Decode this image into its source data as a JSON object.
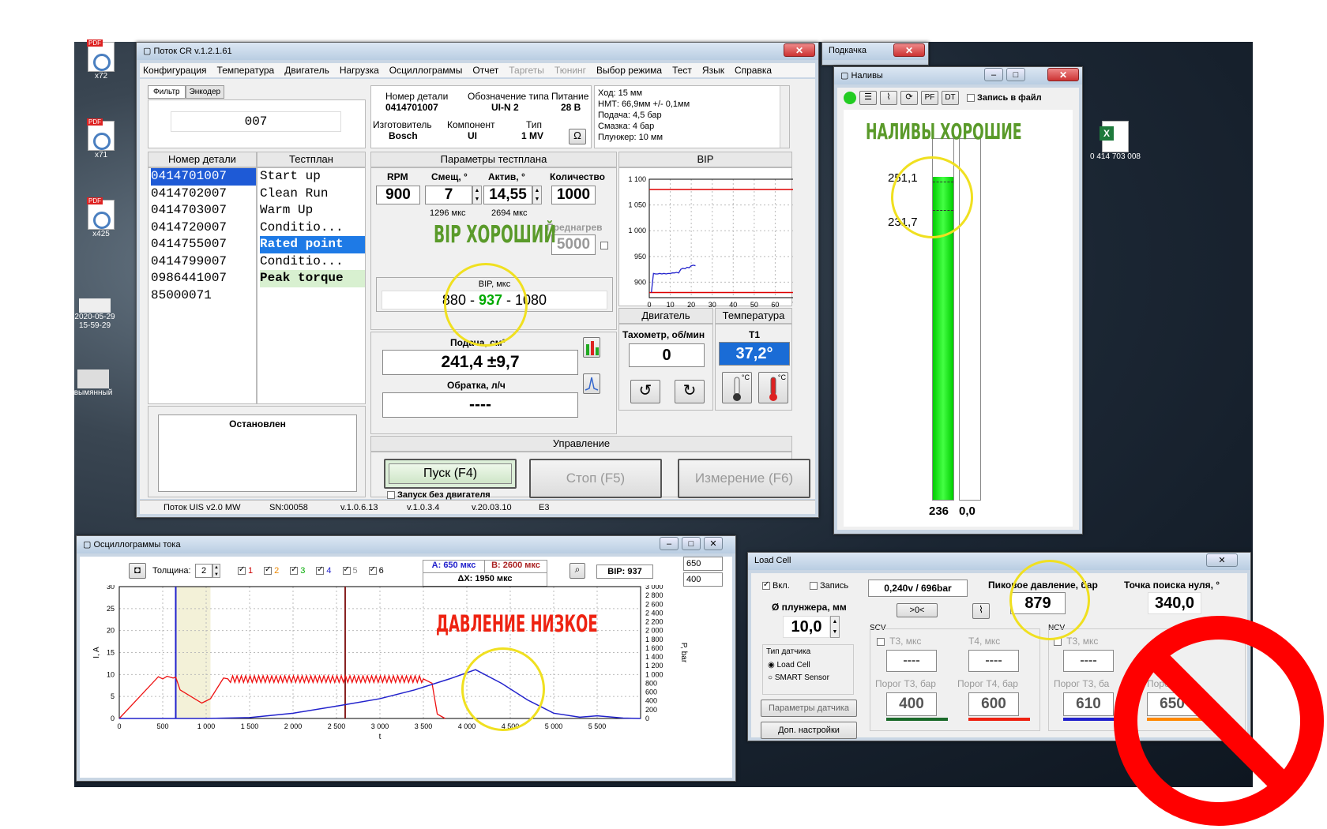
{
  "desktop": {
    "icons": [
      {
        "label": "x72"
      },
      {
        "label": "x71"
      },
      {
        "label": "x425"
      },
      {
        "label": "2020-05-29\n15-59-29"
      },
      {
        "label": "вымянный"
      },
      {
        "label": "0 414 703 008"
      }
    ]
  },
  "main": {
    "title": "Поток CR v.1.2.1.61",
    "menu": [
      "Конфигурация",
      "Температура",
      "Двигатель",
      "Нагрузка",
      "Осциллограммы",
      "Отчет",
      "Таргеты",
      "Тюнинг",
      "Выбор режима",
      "Тест",
      "Язык",
      "Справка"
    ],
    "tabs": [
      "Фильтр",
      "Энкодер"
    ],
    "filter_value": "007",
    "part": {
      "num_label": "Номер детали",
      "num": "0414701007",
      "type_label": "Обозначение типа",
      "type": "UI-N 2",
      "power_label": "Питание",
      "power": "28 В",
      "maker_label": "Изготовитель",
      "maker": "Bosch",
      "comp_label": "Компонент",
      "comp": "UI",
      "kind_label": "Тип",
      "kind": "1 MV"
    },
    "info": [
      "Ход: 15 мм",
      "НМТ: 66,9мм +/- 0,1мм",
      "Подача: 4,5 бар",
      "Смазка: 4 бар",
      "Плунжер: 10 мм"
    ],
    "omega": "Ω",
    "list_header": "Номер детали",
    "testplan_header": "Тестплан",
    "parts": [
      "0414701007",
      "0414702007",
      "0414703007",
      "0414720007",
      "0414755007",
      "0414799007",
      "0986441007",
      "85000071"
    ],
    "testplan": [
      "Start up",
      "Clean Run",
      "Warm Up",
      "Conditio...",
      "Rated point",
      "Conditio...",
      "Peak torque"
    ],
    "status": "Остановлен",
    "params_header": "Параметры тестплана",
    "rpm_label": "RPM",
    "rpm": "900",
    "shift_label": "Смещ, °",
    "shift": "7",
    "shift_us": "1296 мкс",
    "activ_label": "Актив, °",
    "activ": "14,55",
    "activ_us": "2694 мкс",
    "count_label": "Количество",
    "count": "1000",
    "preheat_label": "Преднагрев",
    "preheat": "5000",
    "bip_label": "BIP, мкс",
    "bip_lo": "880",
    "bip_sep1": " - ",
    "bip_val": "937",
    "bip_sep2": " - ",
    "bip_hi": "1080",
    "feed_label": "Подача, см³",
    "feed": "241,4 ±9,7",
    "return_label": "Обратка, л/ч",
    "return": "----",
    "bip_chart_title": "BIP",
    "engine_header": "Двигатель",
    "tacho_label": "Тахометр, об/мин",
    "tacho": "0",
    "temp_header": "Температура",
    "t1_label": "T1",
    "t1": "37,2°",
    "deg_c": "°C",
    "control_header": "Управление",
    "start_btn": "Пуск (F4)",
    "stop_btn": "Стоп (F5)",
    "measure_btn": "Измерение (F6)",
    "no_engine": "Запуск без двигателя",
    "statusbar": [
      "Поток UIS v2.0 MW",
      "SN:00058",
      "v.1.0.6.13",
      "v.1.0.3.4",
      "v.20.03.10",
      "E3"
    ]
  },
  "bip_chart": {
    "type": "line",
    "ylim": [
      870,
      1100
    ],
    "xlim": [
      0,
      70
    ],
    "yticks": [
      "1 100",
      "1 050",
      "1 000",
      "950",
      "900"
    ],
    "xticks": [
      "0",
      "10",
      "20",
      "30",
      "40",
      "50",
      "60",
      "70"
    ],
    "limits": {
      "upper": 1080,
      "lower": 880
    },
    "series": [
      {
        "x": [
          1,
          2,
          3,
          4,
          5,
          6,
          7,
          8,
          9,
          10,
          11,
          12,
          13,
          14,
          15,
          16,
          17,
          18,
          19,
          20,
          21,
          22
        ],
        "y": [
          880,
          917,
          916,
          916,
          917,
          916,
          917,
          916,
          917,
          917,
          918,
          918,
          919,
          918,
          925,
          927,
          926,
          929,
          928,
          932,
          933,
          932
        ]
      }
    ]
  },
  "pod": {
    "title": "Подкачка"
  },
  "naliv": {
    "title": "Наливы",
    "tools": [
      "PF",
      "DT"
    ],
    "record": "Запись в файл",
    "lvl_top": "251,1",
    "lvl_bot": "231,7",
    "bar1": "236",
    "bar2": "0,0",
    "bar1_fraction": 0.895,
    "bar2_fraction": 0.0
  },
  "osc": {
    "title": "Осциллограммы тока",
    "thick_label": "Толщина:",
    "thick": "2",
    "channels": [
      "1",
      "2",
      "3",
      "4",
      "5",
      "6"
    ],
    "a_lbl": "A: 650 мкс",
    "b_lbl": "B: 2600 мкс",
    "dx_lbl": "ΔX: 1950 мкс",
    "bip_lbl": "BIP: 937",
    "v1": "650",
    "v2": "400",
    "ylabel": "I, A",
    "y2label": "P, bar",
    "xlabel": "t"
  },
  "osc_chart": {
    "type": "line",
    "xlim": [
      0,
      6000
    ],
    "ylim": [
      0,
      30
    ],
    "y2lim": [
      0,
      3000
    ],
    "xticks": [
      "0",
      "500",
      "1 000",
      "1 500",
      "2 000",
      "2 500",
      "3 000",
      "3 500",
      "4 000",
      "4 500",
      "5 000",
      "5 500"
    ],
    "yticks": [
      "0",
      "5",
      "10",
      "15",
      "20",
      "25",
      "30"
    ],
    "y2ticks": [
      "0",
      "200",
      "400",
      "600",
      "800",
      "1 000",
      "1 200",
      "1 400",
      "1 600",
      "1 800",
      "2 000",
      "2 200",
      "2 400",
      "2 600",
      "2 800",
      "3 000"
    ],
    "markers": {
      "a": 650,
      "b": 2600,
      "shade": [
        650,
        1050
      ]
    },
    "current": {
      "x": [
        0,
        450,
        500,
        550,
        620,
        650,
        700,
        950,
        1050,
        1200,
        1250,
        3500,
        3600,
        3660,
        3750
      ],
      "y": [
        0,
        9.5,
        9,
        9.6,
        9.2,
        9.4,
        6.5,
        3.5,
        4.5,
        9.2,
        9,
        9,
        8,
        1,
        0
      ]
    },
    "pressure": {
      "x": [
        0,
        1000,
        1500,
        2000,
        2500,
        3000,
        3400,
        3800,
        4100,
        4400,
        4700,
        5000,
        5300,
        5500,
        5800,
        6000
      ],
      "y": [
        0,
        0,
        20,
        120,
        280,
        450,
        650,
        900,
        1110,
        800,
        420,
        120,
        30,
        60,
        10,
        0
      ]
    }
  },
  "load": {
    "title": "Load Cell",
    "on": "Вкл.",
    "rec": "Запись",
    "voltage": "0,240v / 696bar",
    "peak_label": "Пиковое давление, бар",
    "peak": "879",
    "zero_label": "Точка поиска нуля, °",
    "zero": "340,0",
    "plunger_label": "Ø плунжера, мм",
    "plunger": "10,0",
    "arrow": ">0<",
    "sensor_label": "Тип датчика",
    "sensor1": "Load Cell",
    "sensor2": "SMART Sensor",
    "params_btn": "Параметры датчика",
    "extra_btn": "Доп. настройки",
    "scv": "SCV",
    "ncv": "NCV",
    "t3": "T3, мкс",
    "t4": "T4, мкс",
    "t3b": "T3, мкс",
    "dash": "----",
    "thr3": "Порог T3, бар",
    "thr4": "Порог T4, бар",
    "thr3b": "Порог T3, ба",
    "thr4b": "Порог",
    "v400": "400",
    "v600": "600",
    "v610": "610",
    "v650": "650"
  },
  "annotations": {
    "naliv": "НАЛИВЫ ХОРОШИЕ",
    "bip": "BIP ХОРОШИЙ",
    "pressure": "ДАВЛЕНИЕ НИЗКОЕ"
  }
}
